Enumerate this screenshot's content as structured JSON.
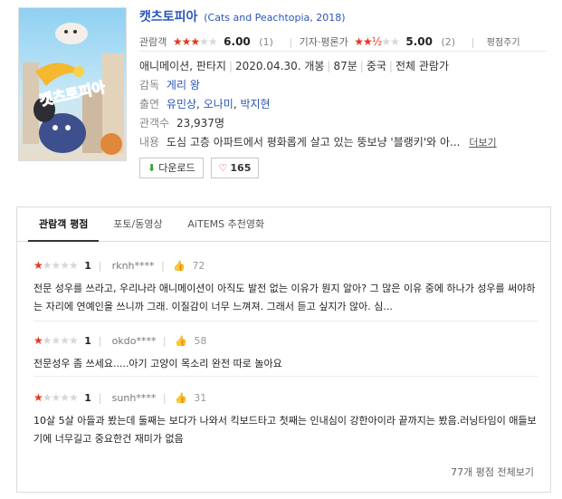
{
  "movie": {
    "title": "캣츠토피아",
    "title_sub": "(Cats and Peachtopia, 2018)",
    "poster_alt": "캣츠토피아 포스터",
    "poster_text": "캣츠토피아"
  },
  "ratings": {
    "audience_label": "관람객",
    "audience_score": "6.00",
    "audience_count": "(1)",
    "audience_stars": 3,
    "critic_label": "기자·평론가",
    "critic_score": "5.00",
    "critic_count": "(2)",
    "critic_stars": 2.5,
    "rate_link": "평점주기"
  },
  "meta": {
    "genre": "애니메이션, 판타지",
    "release": "2020.04.30. 개봉",
    "runtime": "87분",
    "country": "중국",
    "grade": "전체 관람가",
    "director_label": "감독",
    "director": "게리 왕",
    "cast_label": "출연",
    "cast": [
      "유민상",
      "오나미",
      "박지현"
    ],
    "audience_total_label": "관객수",
    "audience_total": "23,937명",
    "plot_label": "내용",
    "plot": "도심 고층 아파트에서 평화롭게 살고 있는 뚱보냥 '블랭키'와 아...",
    "more_label": "더보기"
  },
  "buttons": {
    "download": "다운로드",
    "like_count": "165"
  },
  "tabs": [
    {
      "label": "관람객 평점",
      "active": true
    },
    {
      "label": "포토/동영상",
      "active": false
    },
    {
      "label": "AiTEMS 추천영화",
      "active": false
    }
  ],
  "reviews": [
    {
      "stars": 1,
      "score": "1",
      "user": "rknh****",
      "likes": "72",
      "text": "전문 성우를 쓰라고, 우리나라 애니메이션이 아직도 발전 없는 이유가 뭔지 알아? 그 많은 이유 중에 하나가 성우를 써야하는 자리에 연예인을 쓰니까 그래. 이질감이 너무 느껴져. 그래서 듣고 싶지가 않아. 심..."
    },
    {
      "stars": 1,
      "score": "1",
      "user": "okdo****",
      "likes": "58",
      "text": "전문성우 좀 쓰세요.....아기 고양이 목소리 완전 따로 놀아요"
    },
    {
      "stars": 1,
      "score": "1",
      "user": "sunh****",
      "likes": "31",
      "text": "10살 5살 아들과 봤는데 둘째는 보다가 나와서 킥보드타고 첫째는 인내심이 강한아이라 끝까지는 봤음.러닝타임이 애들보기에 너무길고 중요한건 재미가 없음"
    }
  ],
  "footer": {
    "all_reviews": "77개 평점 전체보기"
  },
  "colors": {
    "link_blue": "#2a55b8",
    "star_red": "#e8361c",
    "heart_red": "#e0362c",
    "download_green": "#3aa23a"
  }
}
